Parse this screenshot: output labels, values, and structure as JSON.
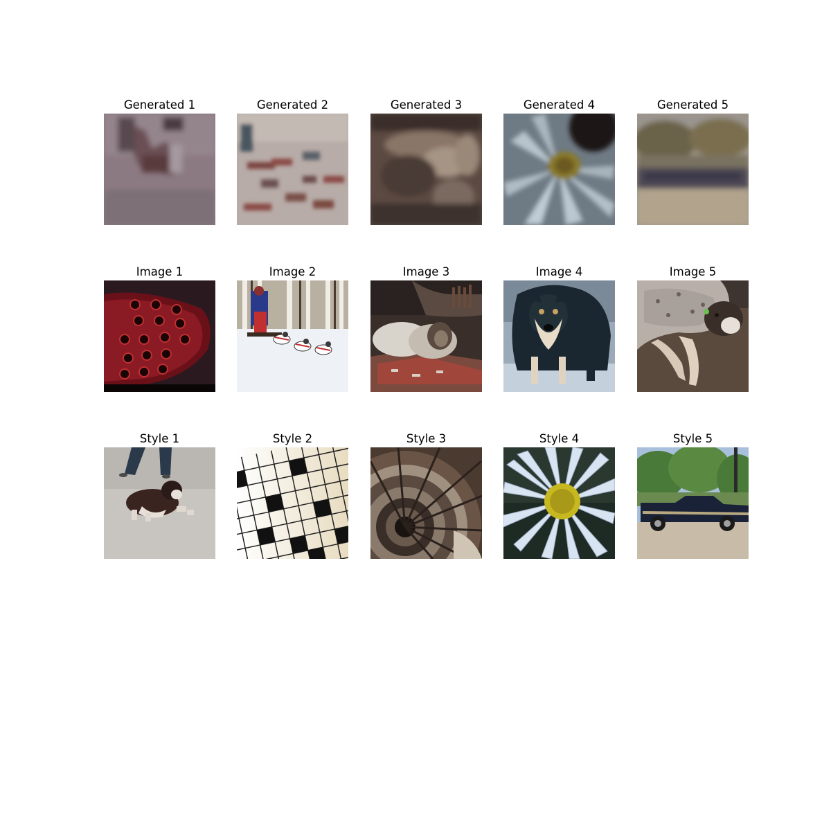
{
  "rows": [
    {
      "name": "generated",
      "titles": [
        "Generated 1",
        "Generated 2",
        "Generated 3",
        "Generated 4",
        "Generated 5"
      ]
    },
    {
      "name": "image",
      "titles": [
        "Image 1",
        "Image 2",
        "Image 3",
        "Image 4",
        "Image 5"
      ]
    },
    {
      "name": "style",
      "titles": [
        "Style 1",
        "Style 2",
        "Style 3",
        "Style 4",
        "Style 5"
      ]
    }
  ]
}
